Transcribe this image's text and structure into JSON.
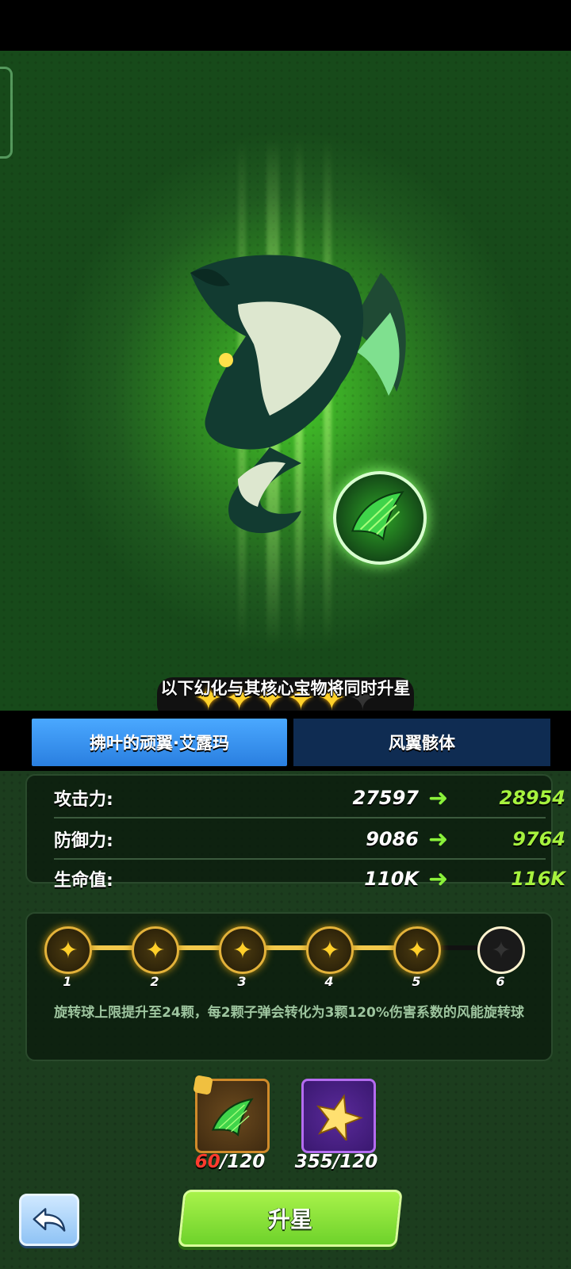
{
  "hero": {
    "star_rating": {
      "filled": 5,
      "max": 6
    },
    "notice": "以下幻化与其核心宝物将同时升星"
  },
  "tabs": [
    {
      "label": "拂叶的顽翼·艾露玛",
      "active": true
    },
    {
      "label": "风翼骸体",
      "active": false
    }
  ],
  "stats": {
    "rows": [
      {
        "label": "攻击力:",
        "current": "27597",
        "next": "28954"
      },
      {
        "label": "防御力:",
        "current": "9086",
        "next": "9764"
      },
      {
        "label": "生命值:",
        "current": "110K",
        "next": "116K"
      }
    ]
  },
  "star_progress": {
    "nodes": [
      "1",
      "2",
      "3",
      "4",
      "5",
      "6"
    ],
    "reached": 5,
    "description": "旋转球上限提升至24颗，每2颗子弹会转化为3颗120%伤害系数的风能旋转球"
  },
  "materials": [
    {
      "icon": "dragon-wing-shard-icon",
      "current": "60",
      "required": "/120",
      "insufficient": true
    },
    {
      "icon": "purple-star-icon",
      "current": "355",
      "required": "/120",
      "insufficient": false
    }
  ],
  "buttons": {
    "upgrade": "升星",
    "back_icon": "back-arrow-icon"
  },
  "colors": {
    "accent_green": "#a6f23e",
    "tab_active": "#3b93f2",
    "tab_inactive": "#0f2c52",
    "star_gold": "#ffd12a",
    "insufficient_red": "#ff3b2e"
  }
}
